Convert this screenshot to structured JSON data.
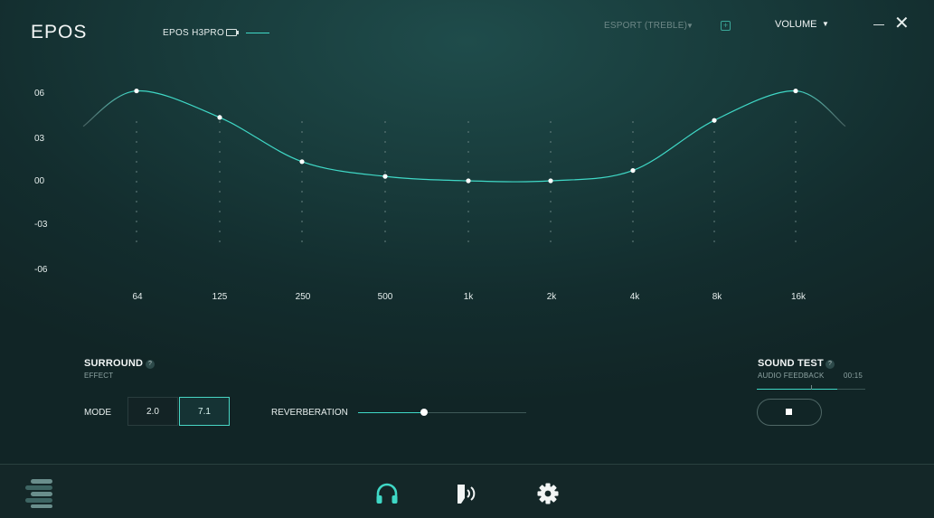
{
  "header": {
    "logo": "EPOS",
    "device": "EPOS H3PRO",
    "preset": "ESPORT (TREBLE)",
    "volume": "VOLUME",
    "plus_glyph": "+",
    "caret_glyph": "▼",
    "close_glyph": "✕"
  },
  "colors": {
    "accent": "#3fd8c6",
    "text": "#e6eeed",
    "muted": "#6d8786"
  },
  "equalizer": {
    "y_labels": [
      "06",
      "03",
      "00",
      "-03",
      "-06"
    ],
    "y_values": [
      6,
      3,
      0,
      -3,
      -6
    ],
    "bands": [
      "64",
      "125",
      "250",
      "500",
      "1k",
      "2k",
      "4k",
      "8k",
      "16k"
    ],
    "gains": [
      6.1,
      4.3,
      1.3,
      0.3,
      0.0,
      0.0,
      0.7,
      4.1,
      6.1
    ]
  },
  "surround": {
    "title": "SURROUND",
    "subtitle": "EFFECT",
    "help": "?",
    "mode_label": "MODE",
    "modes": [
      "2.0",
      "7.1"
    ],
    "selected_mode": "7.1",
    "reverb_label": "REVERBERATION",
    "reverb_level": 0.39
  },
  "sound_test": {
    "title": "SOUND TEST",
    "help": "?",
    "subtitle": "AUDIO FEEDBACK",
    "time": "00:15",
    "progress": 0.74
  },
  "footer": {
    "icons": [
      "menu-icon",
      "headphones-icon",
      "microphone-icon",
      "settings-icon"
    ]
  }
}
